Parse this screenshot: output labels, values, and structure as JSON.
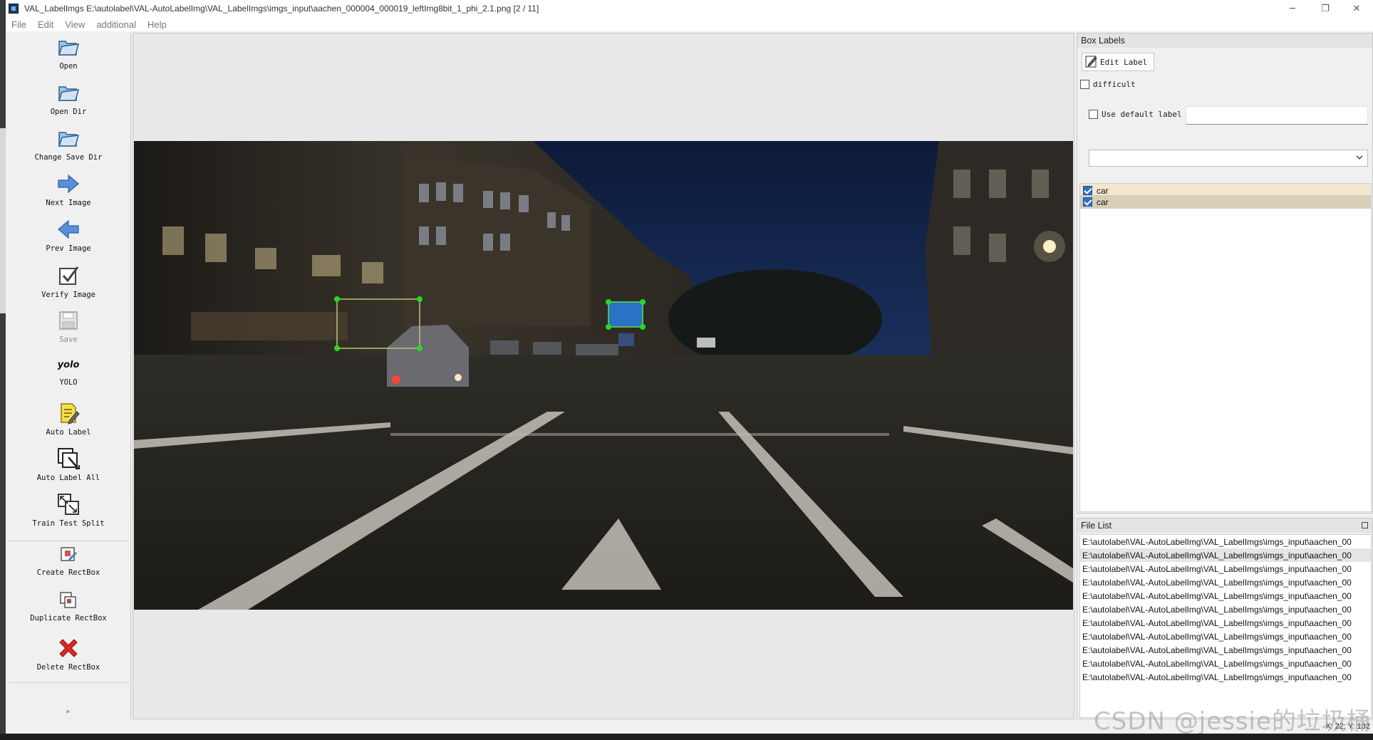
{
  "window": {
    "title": "VAL_LabelImgs E:\\autolabel\\VAL-AutoLabelImg\\VAL_LabelImgs\\imgs_input\\aachen_000004_000019_leftImg8bit_1_phi_2.1.png [2 / 11]",
    "minimize": "─",
    "maximize": "❐",
    "close": "✕"
  },
  "menu": [
    "File",
    "Edit",
    "View",
    "additional",
    "Help"
  ],
  "toolbar": {
    "open": "Open",
    "open_dir": "Open Dir",
    "change_save_dir": "Change Save Dir",
    "next_image": "Next Image",
    "prev_image": "Prev Image",
    "verify_image": "Verify Image",
    "save": "Save",
    "yolo_logo": "yolo",
    "yolo": "YOLO",
    "auto_label": "Auto Label",
    "auto_label_all": "Auto Label All",
    "train_test_split": "Train Test Split",
    "create_rectbox": "Create RectBox",
    "duplicate_rectbox": "Duplicate RectBox",
    "delete_rectbox": "Delete RectBox",
    "more": "»"
  },
  "box_labels": {
    "title": "Box Labels",
    "edit_label": "Edit Label",
    "difficult": "difficult",
    "use_default_label": "Use default label",
    "default_label_value": "",
    "combo_value": "",
    "labels": [
      {
        "text": "car",
        "checked": true
      },
      {
        "text": "car",
        "checked": true
      }
    ]
  },
  "file_list": {
    "title": "File List",
    "files": [
      "E:\\autolabel\\VAL-AutoLabelImg\\VAL_LabelImgs\\imgs_input\\aachen_00",
      "E:\\autolabel\\VAL-AutoLabelImg\\VAL_LabelImgs\\imgs_input\\aachen_00",
      "E:\\autolabel\\VAL-AutoLabelImg\\VAL_LabelImgs\\imgs_input\\aachen_00",
      "E:\\autolabel\\VAL-AutoLabelImg\\VAL_LabelImgs\\imgs_input\\aachen_00",
      "E:\\autolabel\\VAL-AutoLabelImg\\VAL_LabelImgs\\imgs_input\\aachen_00",
      "E:\\autolabel\\VAL-AutoLabelImg\\VAL_LabelImgs\\imgs_input\\aachen_00",
      "E:\\autolabel\\VAL-AutoLabelImg\\VAL_LabelImgs\\imgs_input\\aachen_00",
      "E:\\autolabel\\VAL-AutoLabelImg\\VAL_LabelImgs\\imgs_input\\aachen_00",
      "E:\\autolabel\\VAL-AutoLabelImg\\VAL_LabelImgs\\imgs_input\\aachen_00",
      "E:\\autolabel\\VAL-AutoLabelImg\\VAL_LabelImgs\\imgs_input\\aachen_00",
      "E:\\autolabel\\VAL-AutoLabelImg\\VAL_LabelImgs\\imgs_input\\aachen_00"
    ],
    "selected_index": 1
  },
  "status": {
    "coords": "X: 22; Y: 132"
  },
  "watermark": "CSDN @jessie的垃圾桶",
  "colors": {
    "selected_box": "#2a7fe0",
    "box_handle": "#22dd22",
    "label_row_a": "#f3e8cf",
    "label_row_b": "#d8cfb6"
  }
}
